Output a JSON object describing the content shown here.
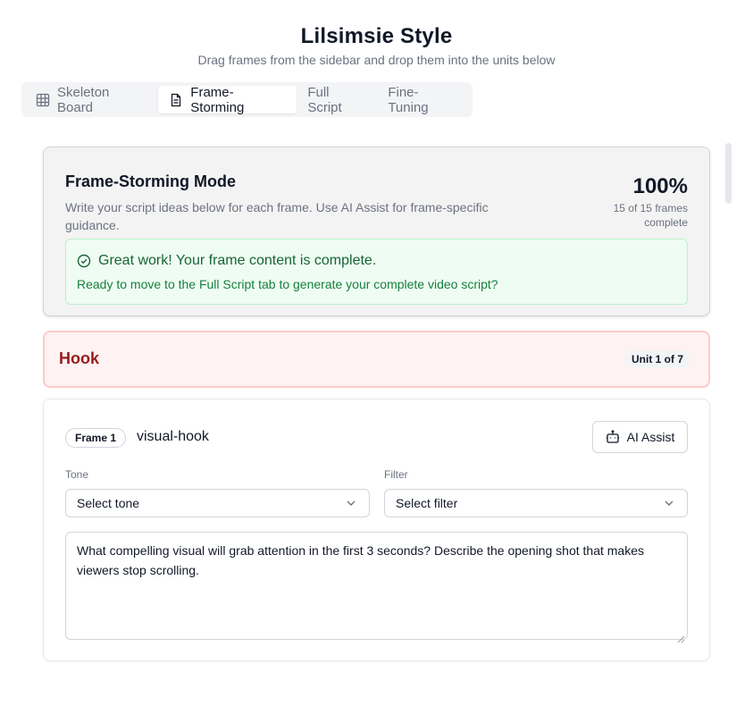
{
  "header": {
    "title": "Lilsimsie Style",
    "subtitle": "Drag frames from the sidebar and drop them into the units below"
  },
  "tabs": [
    {
      "label": "Skeleton Board",
      "icon": "grid-icon",
      "active": false
    },
    {
      "label": "Frame-Storming",
      "icon": "document-icon",
      "active": true
    },
    {
      "label": "Full Script",
      "icon": "",
      "active": false
    },
    {
      "label": "Fine-Tuning",
      "icon": "",
      "active": false
    }
  ],
  "mode": {
    "title": "Frame-Storming Mode",
    "description": "Write your script ideas below for each frame. Use AI Assist for frame-specific guidance.",
    "percent": "100%",
    "progress_text": "15 of 15 frames complete",
    "frames_complete": 15,
    "frames_total": 15,
    "success_title": "Great work! Your frame content is complete.",
    "success_body": "Ready to move to the Full Script tab to generate your complete video script?"
  },
  "unit": {
    "title": "Hook",
    "badge": "Unit 1 of 7",
    "accent": "#991b1b",
    "background": "#fef2f2"
  },
  "frame": {
    "pill": "Frame 1",
    "name": "visual-hook",
    "ai_button": "AI Assist",
    "tone_label": "Tone",
    "tone_value": "Select tone",
    "filter_label": "Filter",
    "filter_value": "Select filter",
    "content": "What compelling visual will grab attention in the first 3 seconds? Describe the opening shot that makes viewers stop scrolling."
  },
  "colors": {
    "success_bg": "#effcf3",
    "success_text": "#166534",
    "muted": "#6b7280"
  }
}
